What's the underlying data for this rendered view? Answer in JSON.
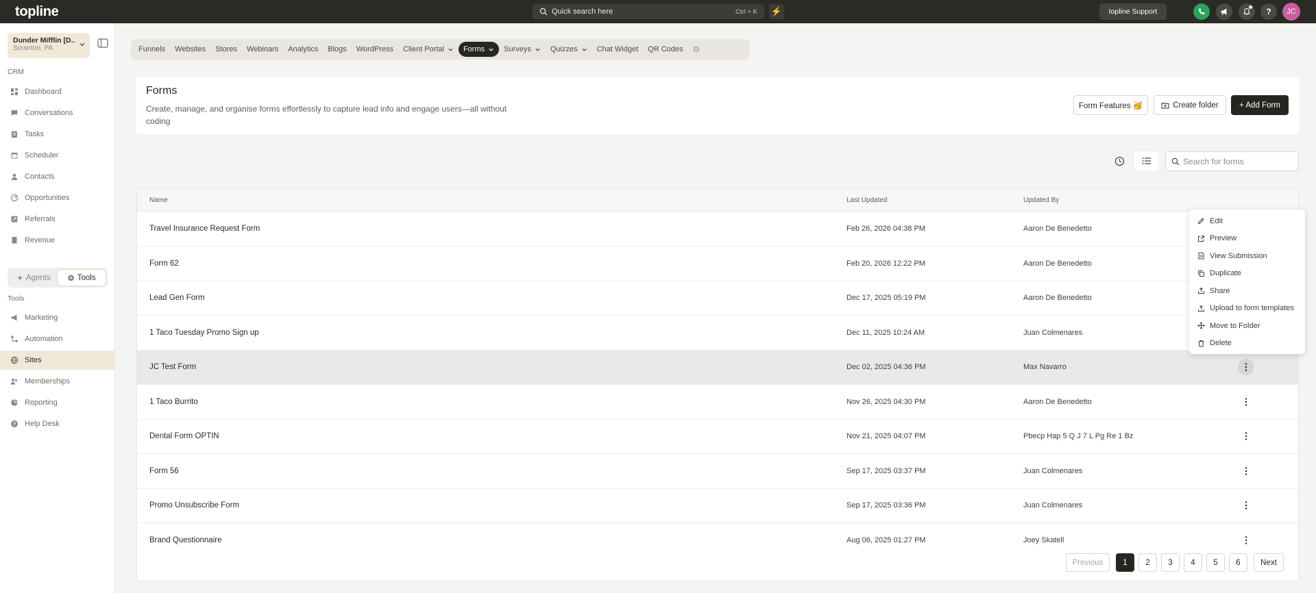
{
  "topbar": {
    "logo": "topline",
    "search_placeholder": "Quick search here",
    "search_shortcut": "Ctrl + K",
    "support_label": "topline Support",
    "avatar_initials": "JC",
    "colors": {
      "bar": "#2b2a26",
      "phone": "#2aa35a",
      "avatar": "#c95f9e",
      "bolt": "#f4c025"
    }
  },
  "sidebar": {
    "account_name": "Dunder Mifflin [D...",
    "account_location": "Scranton, PA",
    "crm_label": "CRM",
    "crm_items": [
      "Dashboard",
      "Conversations",
      "Tasks",
      "Scheduler",
      "Contacts",
      "Opportunities",
      "Referrals",
      "Revenue"
    ],
    "toggle": {
      "agents": "Agents",
      "tools": "Tools",
      "selected": "Tools"
    },
    "tools_label": "Tools",
    "tools_items": [
      "Marketing",
      "Automation",
      "Sites",
      "Memberships",
      "Reporting",
      "Help Desk"
    ],
    "active_item": "Sites"
  },
  "tabs": {
    "items": [
      "Funnels",
      "Websites",
      "Stores",
      "Webinars",
      "Analytics",
      "Blogs",
      "WordPress",
      "Client Portal",
      "Forms",
      "Surveys",
      "Quizzes",
      "Chat Widget",
      "QR Codes"
    ],
    "active": "Forms"
  },
  "header": {
    "title": "Forms",
    "description": "Create, manage, and organise forms effortlessly to capture lead info and engage users—all without coding",
    "features_button": "Form Features 🥳",
    "create_folder_button": "Create folder",
    "add_form_button": "+ Add Form"
  },
  "search": {
    "placeholder": "Search for forms",
    "value": ""
  },
  "table": {
    "columns": {
      "name": "Name",
      "updated": "Last Updated",
      "by": "Updated By"
    },
    "rows": [
      {
        "name": "Travel Insurance Request Form",
        "updated": "Feb 26, 2026 04:38 PM",
        "by": "Aaron De Benedetto"
      },
      {
        "name": "Form 62",
        "updated": "Feb 20, 2026 12:22 PM",
        "by": "Aaron De Benedetto"
      },
      {
        "name": "Lead Gen Form",
        "updated": "Dec 17, 2025 05:19 PM",
        "by": "Aaron De Benedetto"
      },
      {
        "name": "1 Taco Tuesday Promo Sign up",
        "updated": "Dec 11, 2025 10:24 AM",
        "by": "Juan Colmenares"
      },
      {
        "name": "JC Test Form",
        "updated": "Dec 02, 2025 04:36 PM",
        "by": "Max Navarro"
      },
      {
        "name": "1 Taco Burrito",
        "updated": "Nov 26, 2025 04:30 PM",
        "by": "Aaron De Benedetto"
      },
      {
        "name": "Dental Form OPTIN",
        "updated": "Nov 21, 2025 04:07 PM",
        "by": "Pbecp Hap 5 Q J 7 L Pg Re 1 Bz"
      },
      {
        "name": "Form 56",
        "updated": "Sep 17, 2025 03:37 PM",
        "by": "Juan Colmenares"
      },
      {
        "name": "Promo Unsubscribe Form",
        "updated": "Sep 17, 2025 03:36 PM",
        "by": "Juan Colmenares"
      },
      {
        "name": "Brand Questionnaire",
        "updated": "Aug 06, 2025 01:27 PM",
        "by": "Joey Skatell"
      }
    ],
    "highlighted_row": "JC Test Form"
  },
  "context_menu": {
    "items": [
      "Edit",
      "Preview",
      "View Submission",
      "Duplicate",
      "Share",
      "Upload to form templates",
      "Move to Folder",
      "Delete"
    ]
  },
  "pagination": {
    "previous": "Previous",
    "pages": [
      "1",
      "2",
      "3",
      "4",
      "5",
      "6"
    ],
    "current": "1",
    "next": "Next"
  }
}
